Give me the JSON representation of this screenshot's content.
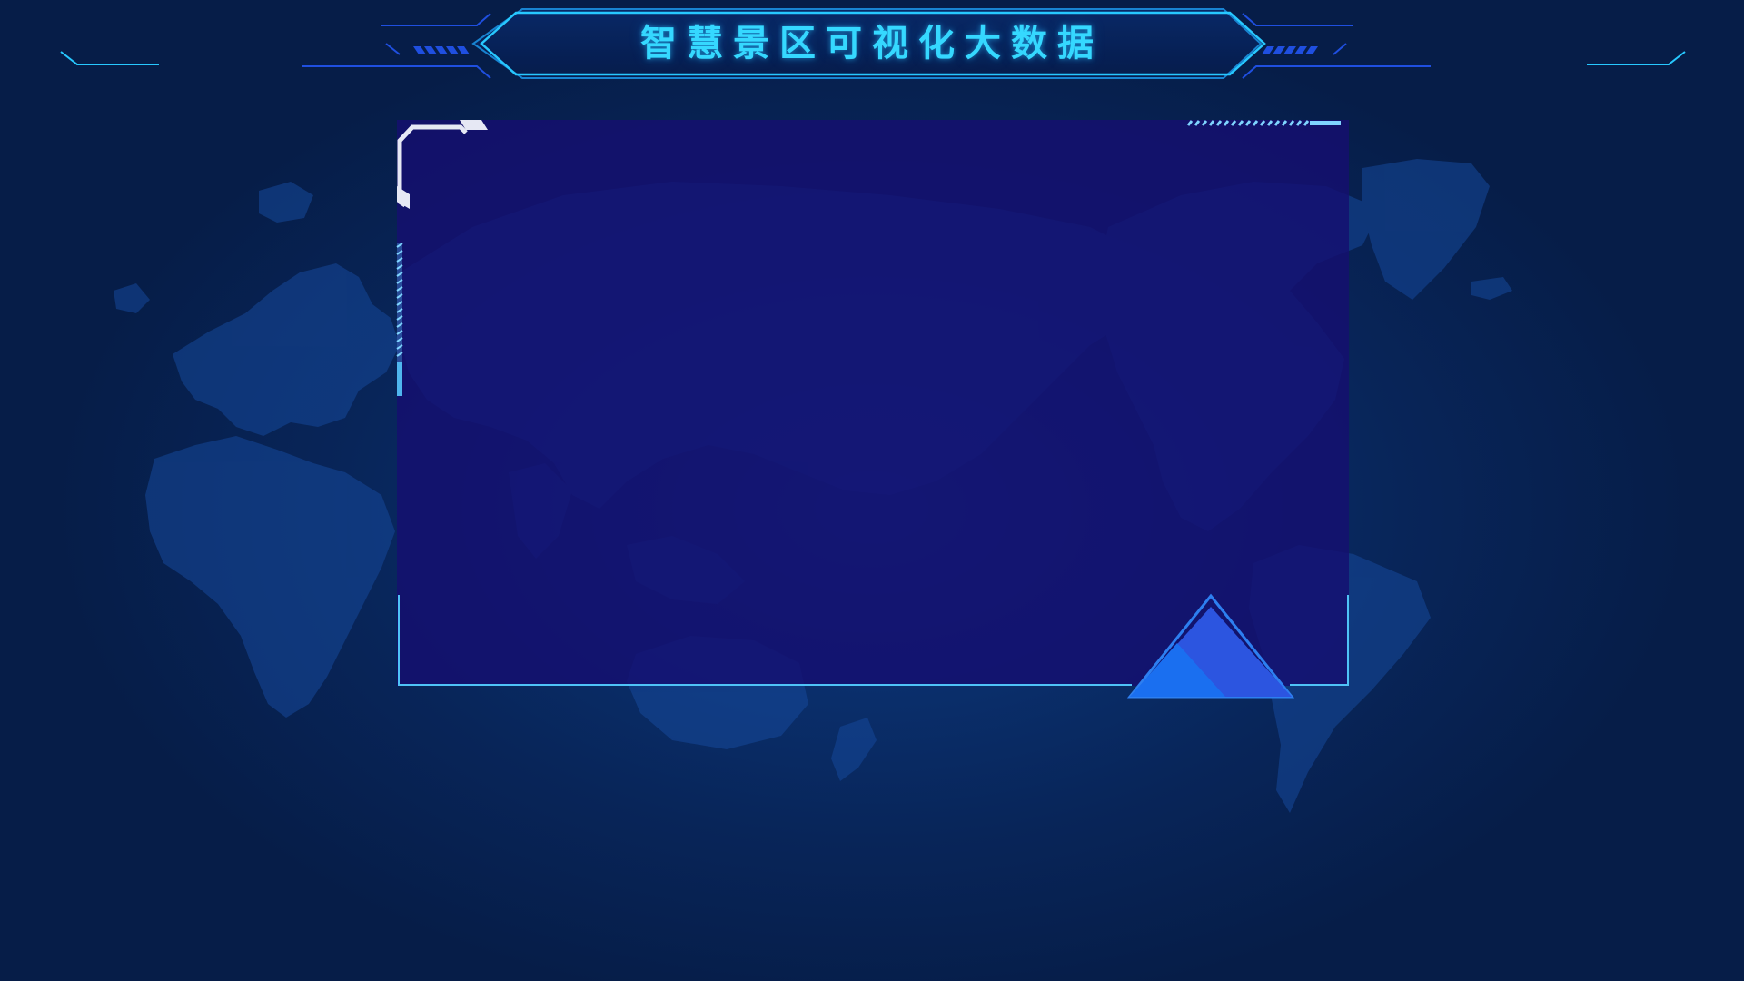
{
  "header": {
    "title": "智慧景区可视化大数据"
  },
  "colors": {
    "background": "#082559",
    "panel_fill": "#150f70",
    "accent_cyan": "#35d8ff",
    "line_blue": "#1e4fd8",
    "triangle_light": "#1a6ff0",
    "triangle_dark": "#2c55e0",
    "map_land": "#1a4ca3"
  },
  "icons": {
    "background": "world-map-silhouette",
    "corner_left": "corner-bracket-icon",
    "triangle": "triangle-marker-icon"
  }
}
